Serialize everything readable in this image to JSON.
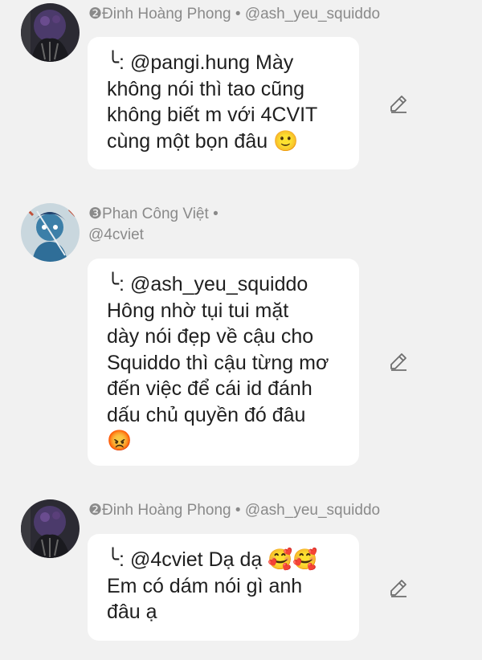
{
  "comments": [
    {
      "rank_icon": "rank-2-badge",
      "author": "❷Đinh Hoàng Phong",
      "separator": " • ",
      "handle": "@ash_yeu_squiddo",
      "reply_icon": "reply-arrow-icon",
      "text": "╰: @pangi.hung Mày\nkhông nói thì tao cũng\nkhông biết m với 4CVIT\ncùng một bọn đâu 🙂",
      "edit_icon": "pencil-icon"
    },
    {
      "rank_icon": "rank-3-badge",
      "author": "❸Phan Công Việt",
      "separator": " •",
      "handle": "@4cviet",
      "text": "╰: @ash_yeu_squiddo\nHông nhờ tụi tui mặt\ndày nói đẹp về cậu cho\nSquiddo thì cậu từng mơ\nđến việc để cái id đánh\ndấu chủ quyền đó đâu\n😡",
      "edit_icon": "pencil-icon"
    },
    {
      "rank_icon": "rank-2-badge",
      "author": "❷Đinh Hoàng Phong",
      "separator": " • ",
      "handle": "@ash_yeu_squiddo",
      "text": "╰: @4cviet Dạ dạ 🥰🥰\nEm có dám nói gì anh\nđâu ạ",
      "edit_icon": "pencil-icon"
    }
  ]
}
